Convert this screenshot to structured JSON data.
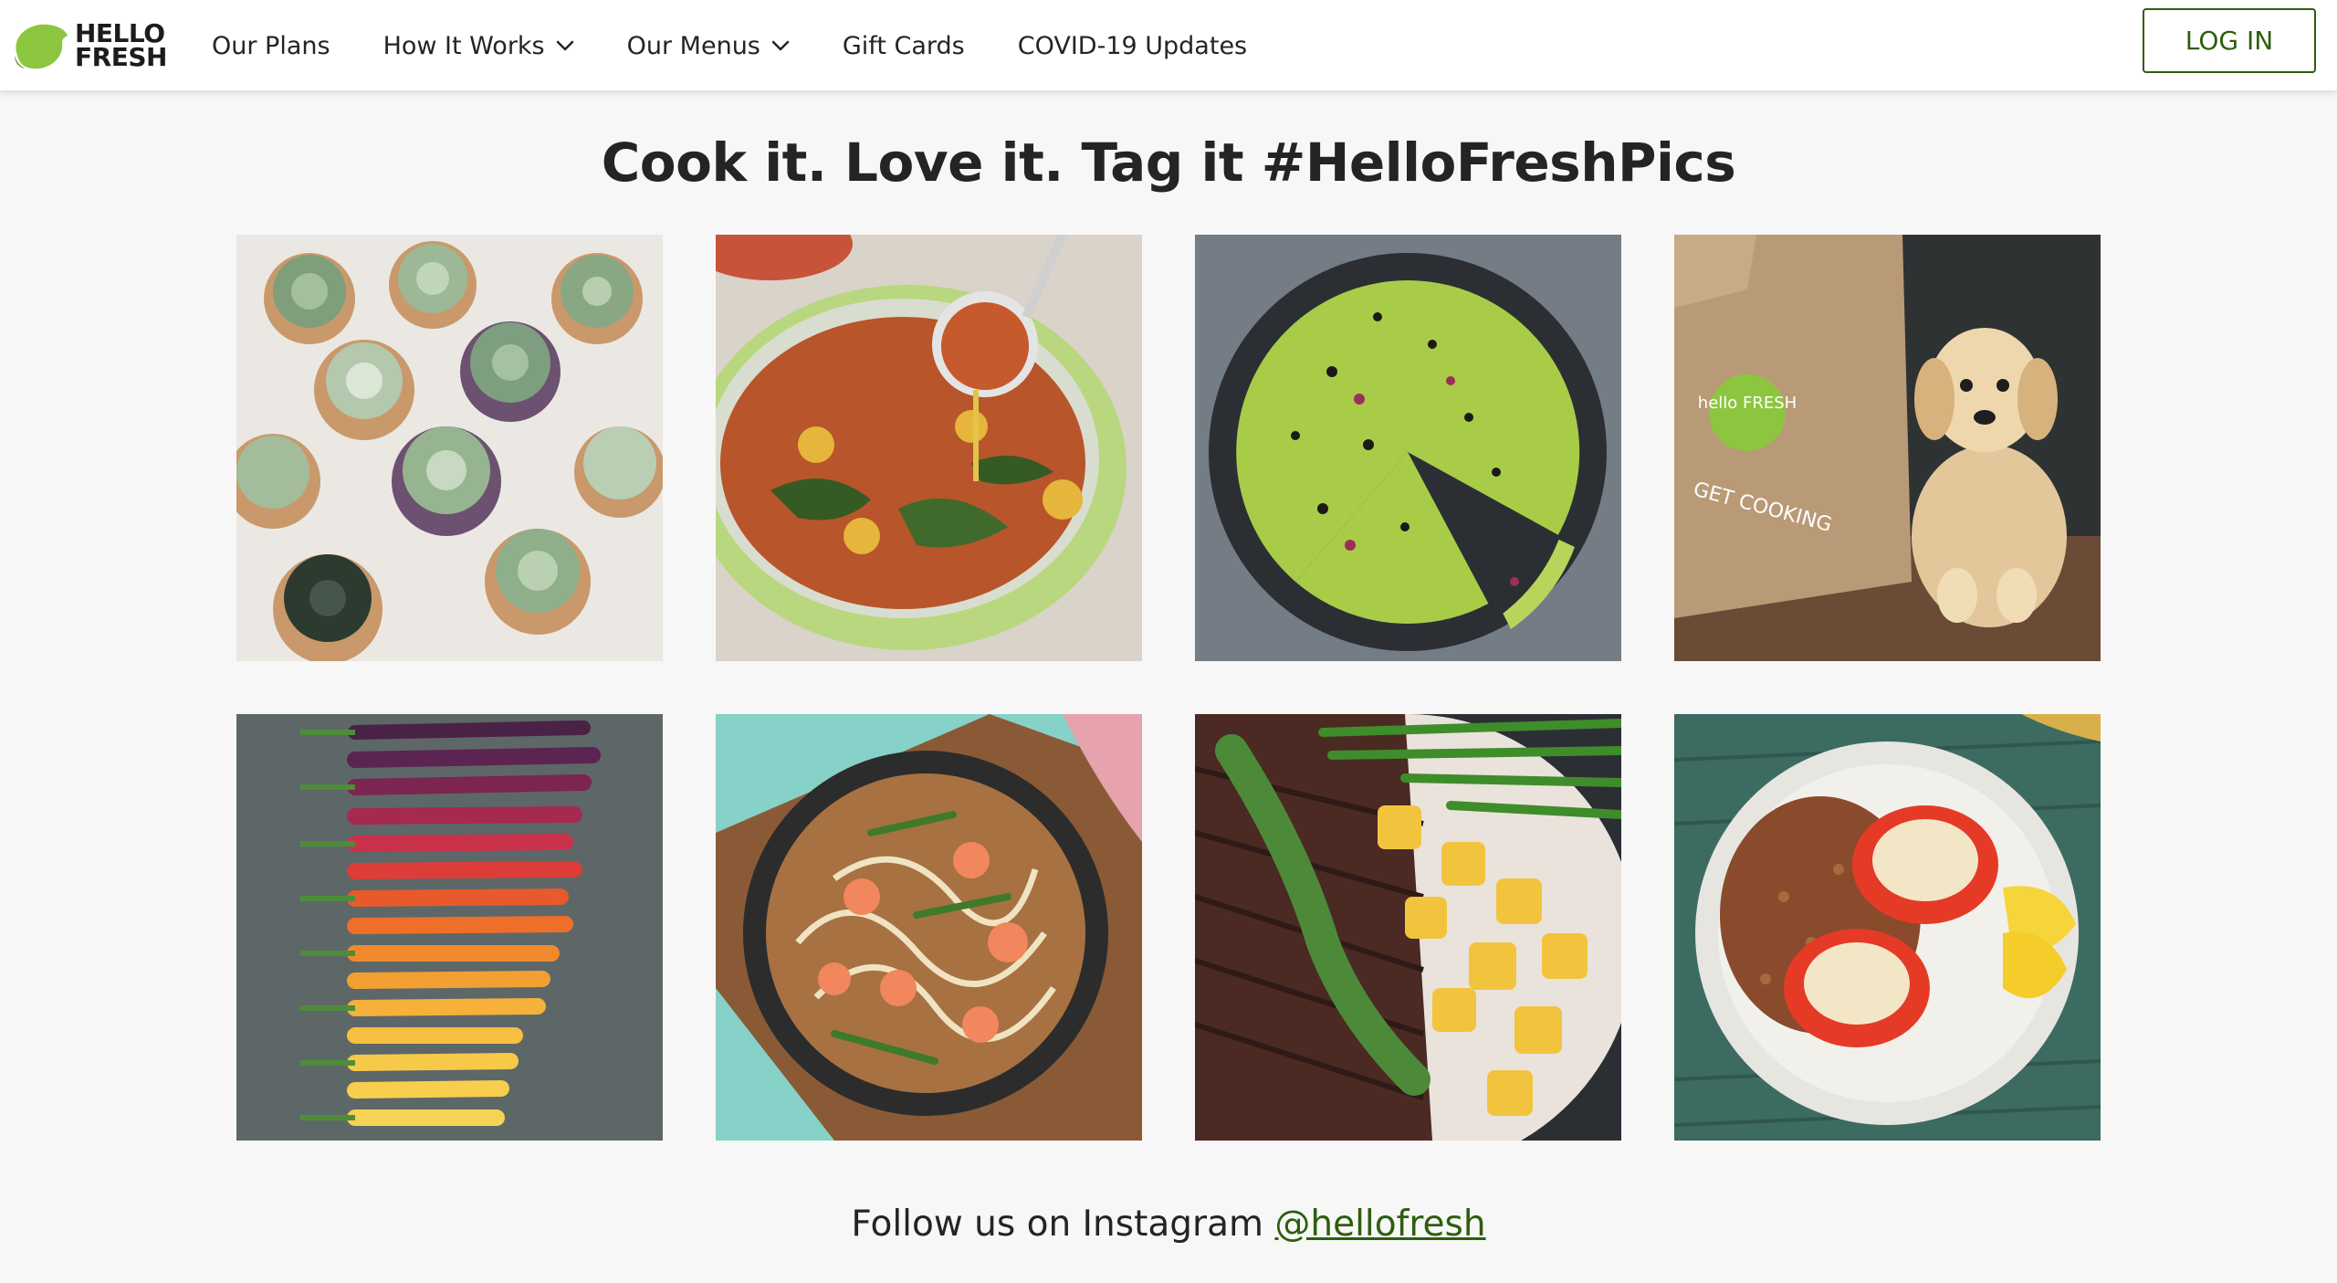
{
  "brand": {
    "logo_line1": "HELLO",
    "logo_line2": "FRESH",
    "accent_color": "#2d5e0f",
    "logo_color": "#8cc63f"
  },
  "nav": {
    "items": [
      {
        "label": "Our Plans",
        "has_dropdown": false
      },
      {
        "label": "How It Works",
        "has_dropdown": true
      },
      {
        "label": "Our Menus",
        "has_dropdown": true
      },
      {
        "label": "Gift Cards",
        "has_dropdown": false
      },
      {
        "label": "COVID-19 Updates",
        "has_dropdown": false
      }
    ],
    "login_label": "LOG IN"
  },
  "main": {
    "title": "Cook it. Love it. Tag it #HelloFreshPics",
    "gallery": [
      {
        "subject": "succulent-cupcakes"
      },
      {
        "subject": "tortellini-soup-pot"
      },
      {
        "subject": "avocado-pizza"
      },
      {
        "subject": "puppy-with-box",
        "box_text": "hello FRESH",
        "box_side_text": "GET COOKING"
      },
      {
        "subject": "rainbow-carrots"
      },
      {
        "subject": "shrimp-udon-bowl"
      },
      {
        "subject": "steak-potatoes-beans"
      },
      {
        "subject": "stuffed-peppers"
      }
    ],
    "follow_text": "Follow us on Instagram ",
    "follow_handle": "@hellofresh"
  }
}
